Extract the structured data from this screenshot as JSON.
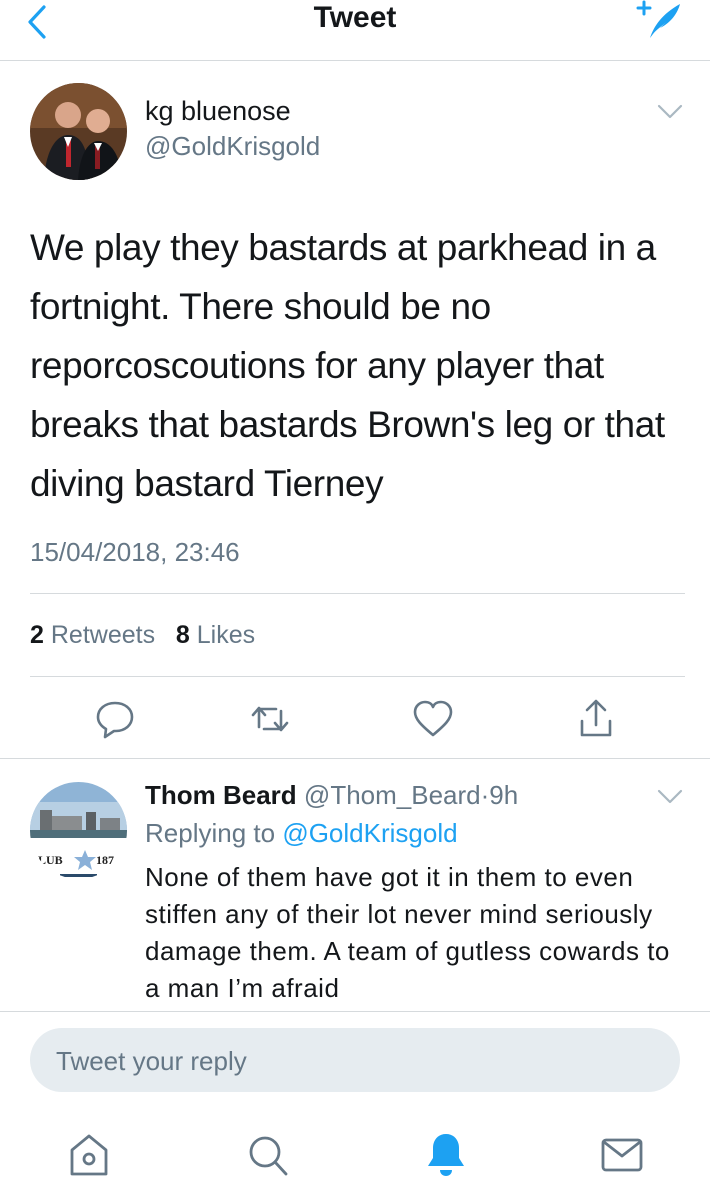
{
  "header": {
    "title": "Tweet",
    "back_icon": "chevron-left-icon",
    "compose_icon": "compose-tweet-icon",
    "accent": "#1da1f2"
  },
  "tweet": {
    "display_name": "kg bluenose",
    "handle": "@GoldKrisgold",
    "text": "We play they bastards at parkhead in a fortnight. There should be no reporcoscoutions for any player that breaks that bastards Brown's leg or that diving bastard Tierney",
    "timestamp": "15/04/2018, 23:46",
    "retweet_count": "2",
    "retweet_label": "Retweets",
    "like_count": "8",
    "like_label": "Likes",
    "actions": [
      "reply-icon",
      "retweet-icon",
      "like-icon",
      "share-icon"
    ]
  },
  "reply": {
    "display_name": "Thom Beard",
    "handle": "@Thom_Beard",
    "dot": "·",
    "age": "9h",
    "replying_prefix": "Replying to",
    "replying_to": "@GoldKrisgold",
    "text": "None of them have got it in them to even stiffen any of their lot never mind seriously damage them. A team of gutless cowards to a man I’m afraid",
    "avatar_text": "LUB",
    "avatar_number": "187"
  },
  "composer": {
    "placeholder": "Tweet your reply"
  },
  "tabbar": {
    "items": [
      "home-icon",
      "search-icon",
      "notifications-icon",
      "messages-icon"
    ],
    "active": "notifications-icon"
  },
  "colors": {
    "secondary_text": "#657786",
    "divider": "#d6dadd",
    "input_bg": "#e6ecf0"
  }
}
